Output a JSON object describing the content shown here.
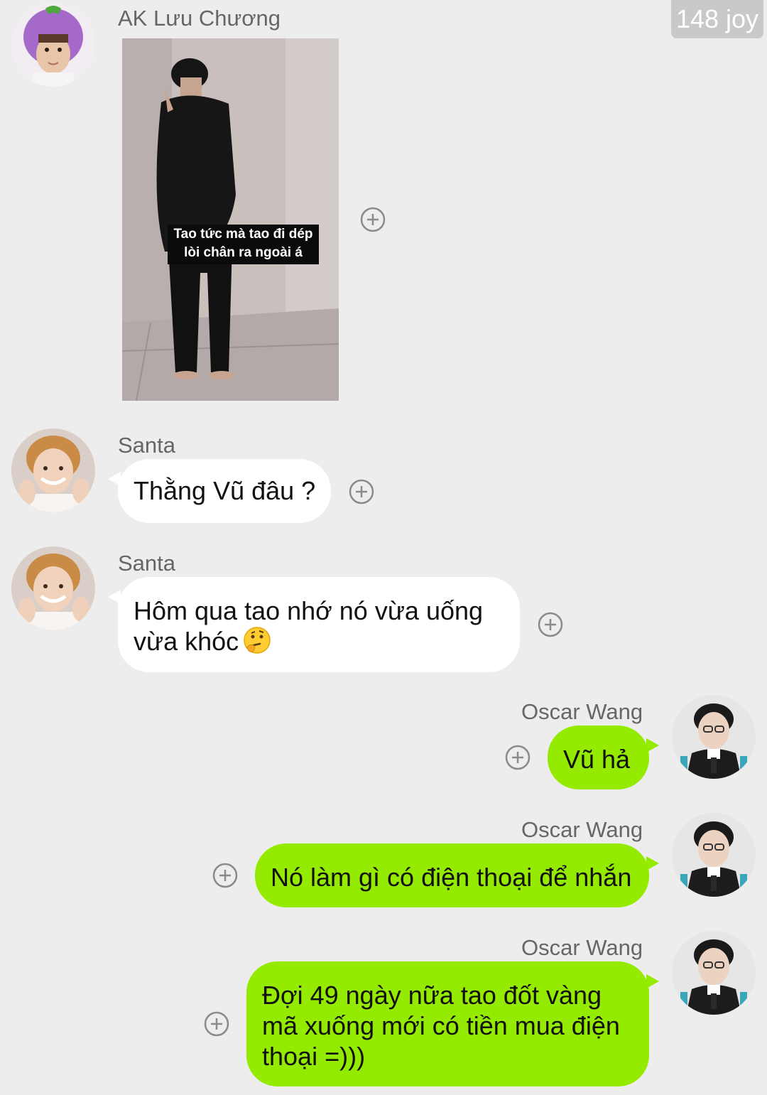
{
  "badge": {
    "text": "148 joy"
  },
  "messages": [
    {
      "sender": "AK Lưu Chương",
      "type": "image",
      "caption_line1": "Tao tức mà tao đi dép",
      "caption_line2": "lòi chân ra ngoài á",
      "avatar": "avatar-eggplant-hat"
    },
    {
      "sender": "Santa",
      "text": "Thằng Vũ đâu ?",
      "avatar": "avatar-santa"
    },
    {
      "sender": "Santa",
      "text_line1": "Hôm qua tao nhớ nó vừa uống",
      "text_line2": "vừa khóc",
      "emoji": "thinking-face-icon",
      "avatar": "avatar-santa"
    },
    {
      "sender": "Oscar Wang",
      "text": "Vũ hả",
      "avatar": "avatar-oscar"
    },
    {
      "sender": "Oscar Wang",
      "text": "Nó làm gì có điện thoại để nhắn",
      "avatar": "avatar-oscar"
    },
    {
      "sender": "Oscar Wang",
      "text_line1": "Đợi 49 ngày nữa tao đốt vàng",
      "text_line2": "mã xuống mới có tiền mua điện",
      "text_line3": "thoại =)))",
      "avatar": "avatar-oscar"
    }
  ],
  "colors": {
    "background": "#ededed",
    "incoming_bubble": "#ffffff",
    "outgoing_bubble": "#94eb00",
    "sender_name": "#666666",
    "badge": "#c9c9c9"
  }
}
